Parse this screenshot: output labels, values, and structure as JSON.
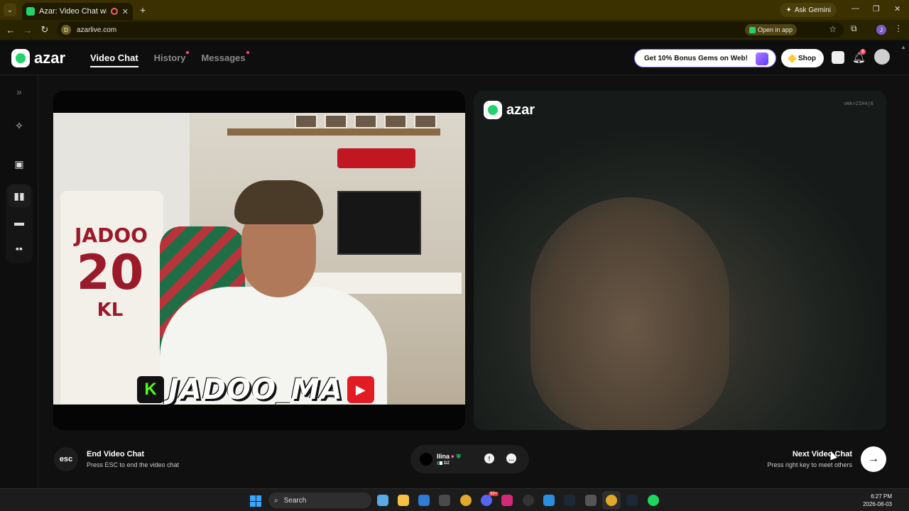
{
  "browser": {
    "tab_title": "Azar: Video Chat with New",
    "new_tab": "+",
    "ask_gemini": "Ask Gemini",
    "url": "azarlive.com",
    "open_in_app": "Open in app",
    "site_icon": "D",
    "profile_initial": "J"
  },
  "header": {
    "logo_text": "azar",
    "nav": [
      {
        "label": "Video Chat",
        "active": true
      },
      {
        "label": "History",
        "active": false
      },
      {
        "label": "Messages",
        "active": false
      }
    ],
    "promo": "Get 10% Bonus Gems on Web!",
    "shop": "Shop",
    "notification_count": "8"
  },
  "video": {
    "streamer_name": "JADOO_MA",
    "jersey_name": "JADOO",
    "jersey_number": "20",
    "jersey_initials": "KL",
    "remote_logo_text": "azar",
    "session_id": "vWk=2IH4j6"
  },
  "controls": {
    "esc_label": "esc",
    "end_title": "End Video Chat",
    "end_subtitle": "Press ESC to end the video chat",
    "peer_name": "Ilina",
    "peer_country": "DZ",
    "next_title": "Next Video Chat",
    "next_subtitle": "Press right key to meet others"
  },
  "taskbar": {
    "search_label": "Search",
    "time": "6:27 PM",
    "date": "2026-08-03",
    "notification_badge": "99+"
  },
  "colors": {
    "brand_green": "#21d36b",
    "chrome_bg": "#3a3000",
    "alert_red": "#ff4d6d"
  }
}
